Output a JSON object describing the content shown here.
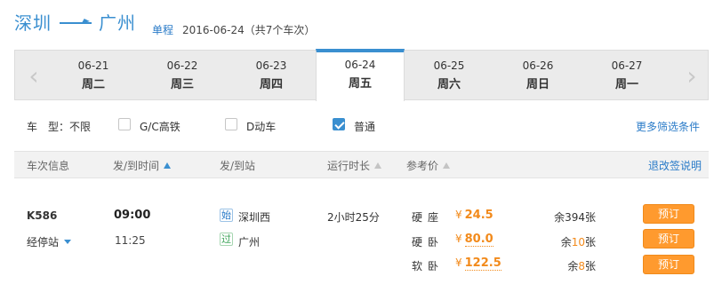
{
  "header": {
    "from_city": "深圳",
    "to_city": "广州",
    "trip_type": "单程",
    "date_summary": "2016-06-24（共7个车次）"
  },
  "date_bar": {
    "dates": [
      {
        "date": "06-21",
        "weekday": "周二"
      },
      {
        "date": "06-22",
        "weekday": "周三"
      },
      {
        "date": "06-23",
        "weekday": "周四"
      },
      {
        "date": "06-24",
        "weekday": "周五"
      },
      {
        "date": "06-25",
        "weekday": "周六"
      },
      {
        "date": "06-26",
        "weekday": "周日"
      },
      {
        "date": "06-27",
        "weekday": "周一"
      }
    ],
    "active_index": 3
  },
  "filters": {
    "label": "车　型：不限",
    "options": [
      {
        "label": "G/C高铁",
        "checked": false
      },
      {
        "label": "D动车",
        "checked": false
      },
      {
        "label": "普通",
        "checked": true
      }
    ],
    "more": "更多筛选条件"
  },
  "table": {
    "headers": [
      "车次信息",
      "发/到时间",
      "发/到站",
      "运行时长",
      "参考价"
    ],
    "refund_link": "退改签说明"
  },
  "train": {
    "number": "K586",
    "stops_label": "经停站",
    "depart_time": "09:00",
    "arrive_time": "11:25",
    "start_tag": "始",
    "pass_tag": "过",
    "from_station": "深圳西",
    "to_station": "广州",
    "duration": "2小时25分",
    "seats": [
      {
        "type": "硬座",
        "price": "24.5",
        "remain_prefix": "余",
        "remain": "394",
        "remain_suffix": "张",
        "book": "预订"
      },
      {
        "type": "硬卧",
        "price": "80.0",
        "remain_prefix": "余",
        "remain": "10",
        "remain_suffix": "张",
        "book": "预订"
      },
      {
        "type": "软卧",
        "price": "122.5",
        "remain_prefix": "余",
        "remain": "8",
        "remain_suffix": "张",
        "book": "预订"
      }
    ],
    "currency": "¥"
  },
  "colors": {
    "accent": "#3a8fd0",
    "price": "#f28a1b",
    "button": "#ff9a2e"
  }
}
